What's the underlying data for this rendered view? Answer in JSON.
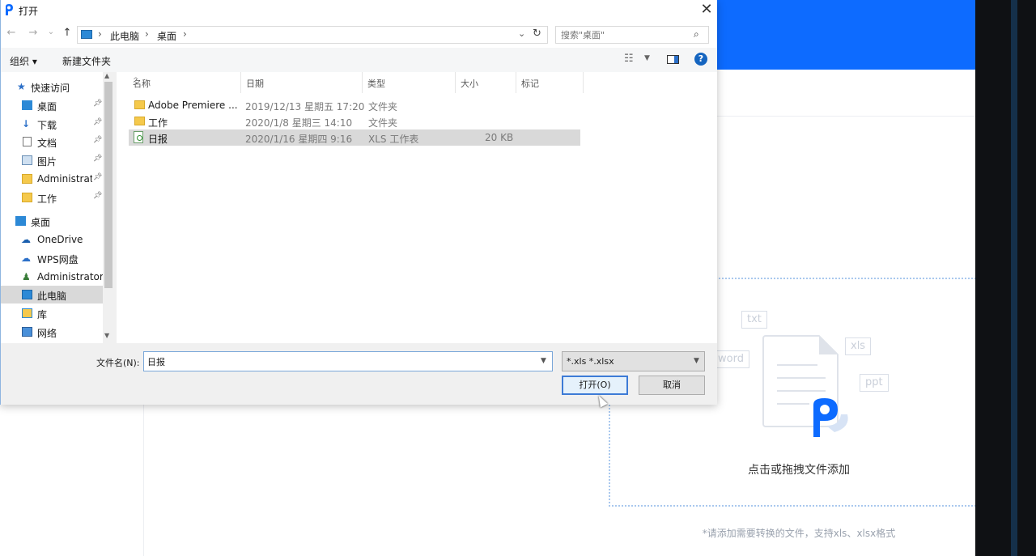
{
  "app": {
    "drop_text": "点击或拖拽文件添加",
    "hint": "*请添加需要转换的文件，支持xls、xlsx格式",
    "format_tags": [
      "txt",
      "word",
      "xls",
      "ppt"
    ],
    "brand_color": "#0d6bff"
  },
  "dialog": {
    "title": "打开",
    "close_label": "✕",
    "nav": {
      "back": "←",
      "forward": "→",
      "recent": "⌄",
      "up": "↑"
    },
    "breadcrumb": [
      "此电脑",
      "桌面"
    ],
    "search_placeholder": "搜索\"桌面\"",
    "commands": {
      "organize": "组织 ▾",
      "new_folder": "新建文件夹"
    },
    "nav_pane": {
      "quick_access": "快速访问",
      "items": [
        {
          "label": "桌面",
          "icon": "desktop-icon",
          "pinned": true
        },
        {
          "label": "下载",
          "icon": "download-icon",
          "pinned": true
        },
        {
          "label": "文档",
          "icon": "document-icon",
          "pinned": true
        },
        {
          "label": "图片",
          "icon": "picture-icon",
          "pinned": true
        },
        {
          "label": "Administrato",
          "icon": "folder-icon",
          "pinned": true
        },
        {
          "label": "工作",
          "icon": "folder-icon",
          "pinned": true
        }
      ],
      "tree": [
        {
          "label": "桌面",
          "icon": "desktop-icon"
        },
        {
          "label": "OneDrive",
          "icon": "cloud-icon"
        },
        {
          "label": "WPS网盘",
          "icon": "cloud-icon"
        },
        {
          "label": "Administrator",
          "icon": "user-icon"
        },
        {
          "label": "此电脑",
          "icon": "computer-icon",
          "selected": true
        },
        {
          "label": "库",
          "icon": "library-icon"
        },
        {
          "label": "网络",
          "icon": "network-icon"
        }
      ]
    },
    "columns": [
      "名称",
      "日期",
      "类型",
      "大小",
      "标记"
    ],
    "files": [
      {
        "name": "Adobe Premiere ...",
        "date": "2019/12/13 星期五 17:20",
        "type": "文件夹",
        "size": "",
        "kind": "folder"
      },
      {
        "name": "工作",
        "date": "2020/1/8 星期三 14:10",
        "type": "文件夹",
        "size": "",
        "kind": "folder"
      },
      {
        "name": "日报",
        "date": "2020/1/16 星期四 9:16",
        "type": "XLS 工作表",
        "size": "20 KB",
        "kind": "xls",
        "selected": true
      }
    ],
    "filename_label": "文件名(N):",
    "filename_value": "日报",
    "filetype_value": "*.xls *.xlsx",
    "open_button": "打开(O)",
    "cancel_button": "取消"
  }
}
